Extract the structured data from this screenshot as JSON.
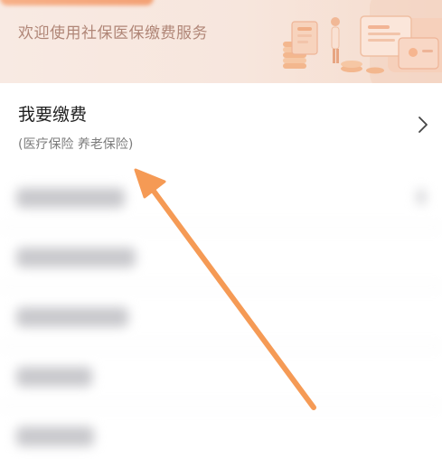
{
  "banner": {
    "text": "欢迎使用社保医保缴费服务",
    "colors": {
      "accent": "#f3a175",
      "bg": "#f7e6dd"
    }
  },
  "pay_item": {
    "title": "我要缴费",
    "subtitle": "(医疗保险 养老保险)"
  },
  "annotation": {
    "arrow_color": "#f59a55",
    "icon": "pointer-arrow"
  }
}
